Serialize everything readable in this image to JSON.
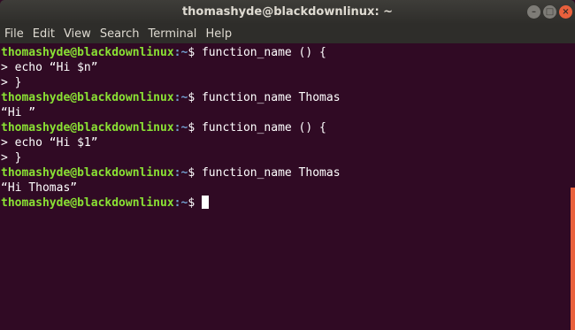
{
  "window": {
    "title": "thomashyde@blackdownlinux: ~",
    "minimize_glyph": "–",
    "maximize_glyph": "□",
    "close_glyph": "×"
  },
  "menu": [
    "File",
    "Edit",
    "View",
    "Search",
    "Terminal",
    "Help"
  ],
  "prompt": {
    "user_host": "thomashyde@blackdownlinux",
    "path": ":~",
    "symbol": "$"
  },
  "lines": [
    {
      "type": "prompt",
      "text": " function_name () {"
    },
    {
      "type": "output",
      "text": "> echo “Hi $n”"
    },
    {
      "type": "output",
      "text": "> }"
    },
    {
      "type": "prompt",
      "text": " function_name Thomas"
    },
    {
      "type": "output",
      "text": "“Hi ”"
    },
    {
      "type": "prompt",
      "text": " function_name () {"
    },
    {
      "type": "output",
      "text": "> echo “Hi $1”"
    },
    {
      "type": "output",
      "text": "> }"
    },
    {
      "type": "prompt",
      "text": " function_name Thomas"
    },
    {
      "type": "output",
      "text": "“Hi Thomas”"
    },
    {
      "type": "prompt",
      "text": ""
    }
  ],
  "colors": {
    "background": "#300a24",
    "user_host": "#8ae234",
    "path": "#729fcf",
    "scrollbar": "#e9603c"
  }
}
